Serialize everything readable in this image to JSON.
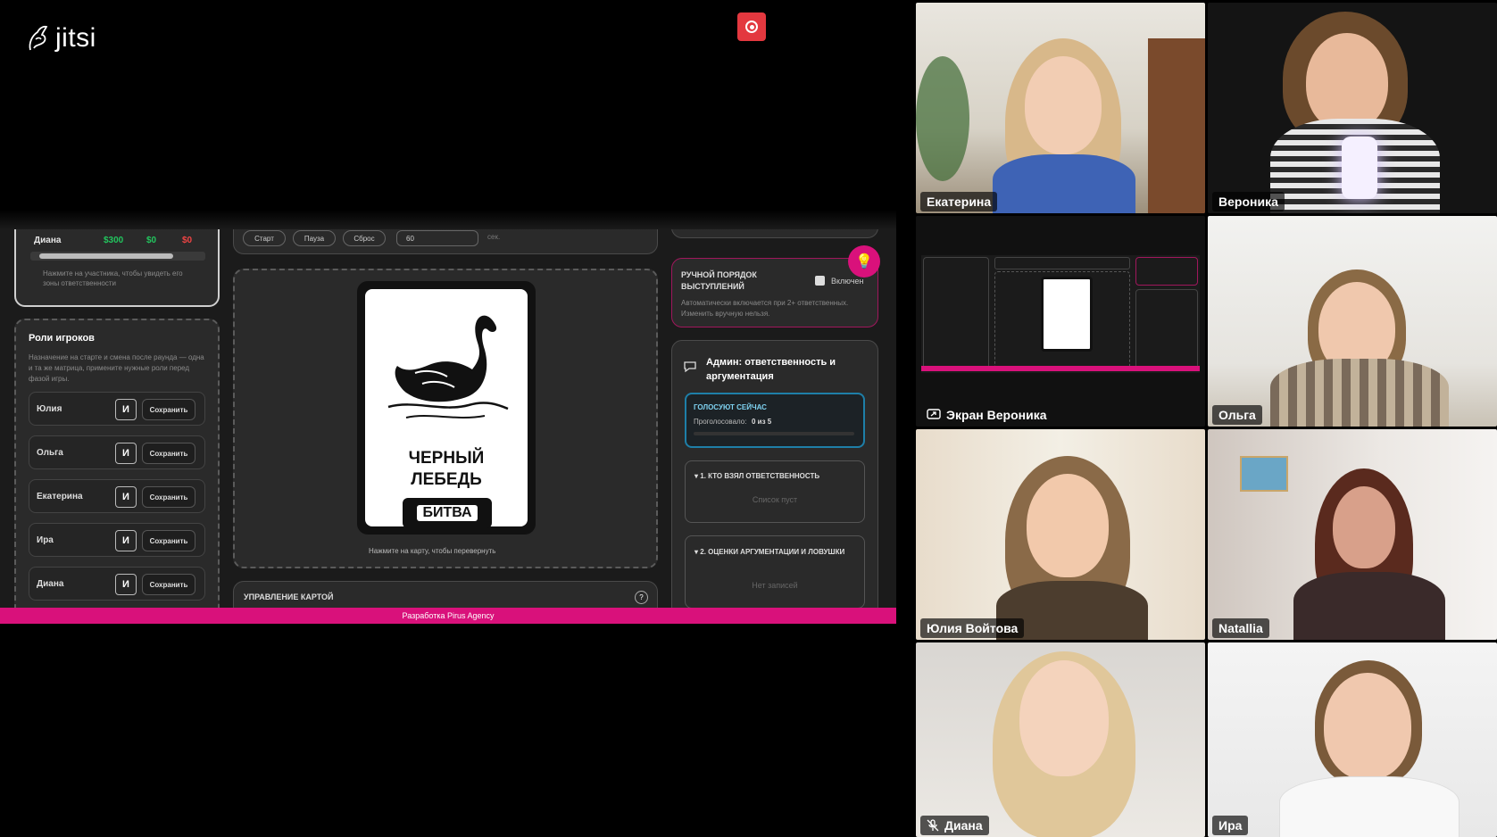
{
  "app": {
    "logo_text": "jitsi",
    "record_icon": "record-icon"
  },
  "shared_screen": {
    "top_left": {
      "player_name": "Диана",
      "amounts": [
        "$300",
        "$0",
        "$0"
      ],
      "amount_colors": [
        "#22c55e",
        "#22c55e",
        "#ef4444"
      ],
      "hint": "Нажмите на участника, чтобы увидеть его зоны ответственности"
    },
    "roles": {
      "title": "Роли игроков",
      "description": "Назначение на старте и смена после раунда — одна и та же матрица, примените нужные роли перед фазой игры.",
      "rows": [
        {
          "name": "Юлия",
          "role": "И",
          "save": "Сохранить"
        },
        {
          "name": "Ольга",
          "role": "И",
          "save": "Сохранить"
        },
        {
          "name": "Екатерина",
          "role": "И",
          "save": "Сохранить"
        },
        {
          "name": "Ира",
          "role": "И",
          "save": "Сохранить"
        },
        {
          "name": "Диана",
          "role": "И",
          "save": "Сохранить"
        }
      ]
    },
    "timer": {
      "buttons": [
        "Старт",
        "Пауза",
        "Сброс"
      ],
      "value": "60",
      "unit": "сек."
    },
    "card": {
      "title_line1": "ЧЕРНЫЙ",
      "title_line2": "ЛЕБЕДЬ",
      "badge": "БИТВА",
      "hint": "Нажмите на карту, чтобы перевернуть"
    },
    "card_control": {
      "title": "УПРАВЛЕНИЕ КАРТОЙ",
      "help": "?"
    },
    "manual_order": {
      "title": "РУЧНОЙ ПОРЯДОК ВЫСТУПЛЕНИЙ",
      "toggle_label": "Включен",
      "description": "Автоматически включается при 2+ ответственных. Изменить вручную нельзя."
    },
    "admin": {
      "title": "Админ: ответственность и аргументация",
      "voting_title": "ГОЛОСУЮТ СЕЙЧАС",
      "voted_label": "Проголосовало:",
      "voted_value": "0 из 5",
      "section1_title": "▾ 1. КТО ВЗЯЛ ОТВЕТСТВЕННОСТЬ",
      "section1_empty": "Список пуст",
      "section2_title": "▾ 2. ОЦЕНКИ АРГУМЕНТАЦИИ И ЛОВУШКИ",
      "section2_empty": "Нет записей"
    },
    "footer": "Разработка Pirus Agency"
  },
  "participants": [
    {
      "name": "Екатерина"
    },
    {
      "name": "Вероника"
    },
    {
      "name": "Экран Вероника"
    },
    {
      "name": "Ольга"
    },
    {
      "name": "Юлия Войтова"
    },
    {
      "name": "Natallia"
    },
    {
      "name": "Диана"
    },
    {
      "name": "Ира"
    }
  ],
  "colors": {
    "accent": "#d9117b",
    "record": "#e3383f",
    "voting_border": "#1e7fa8"
  }
}
